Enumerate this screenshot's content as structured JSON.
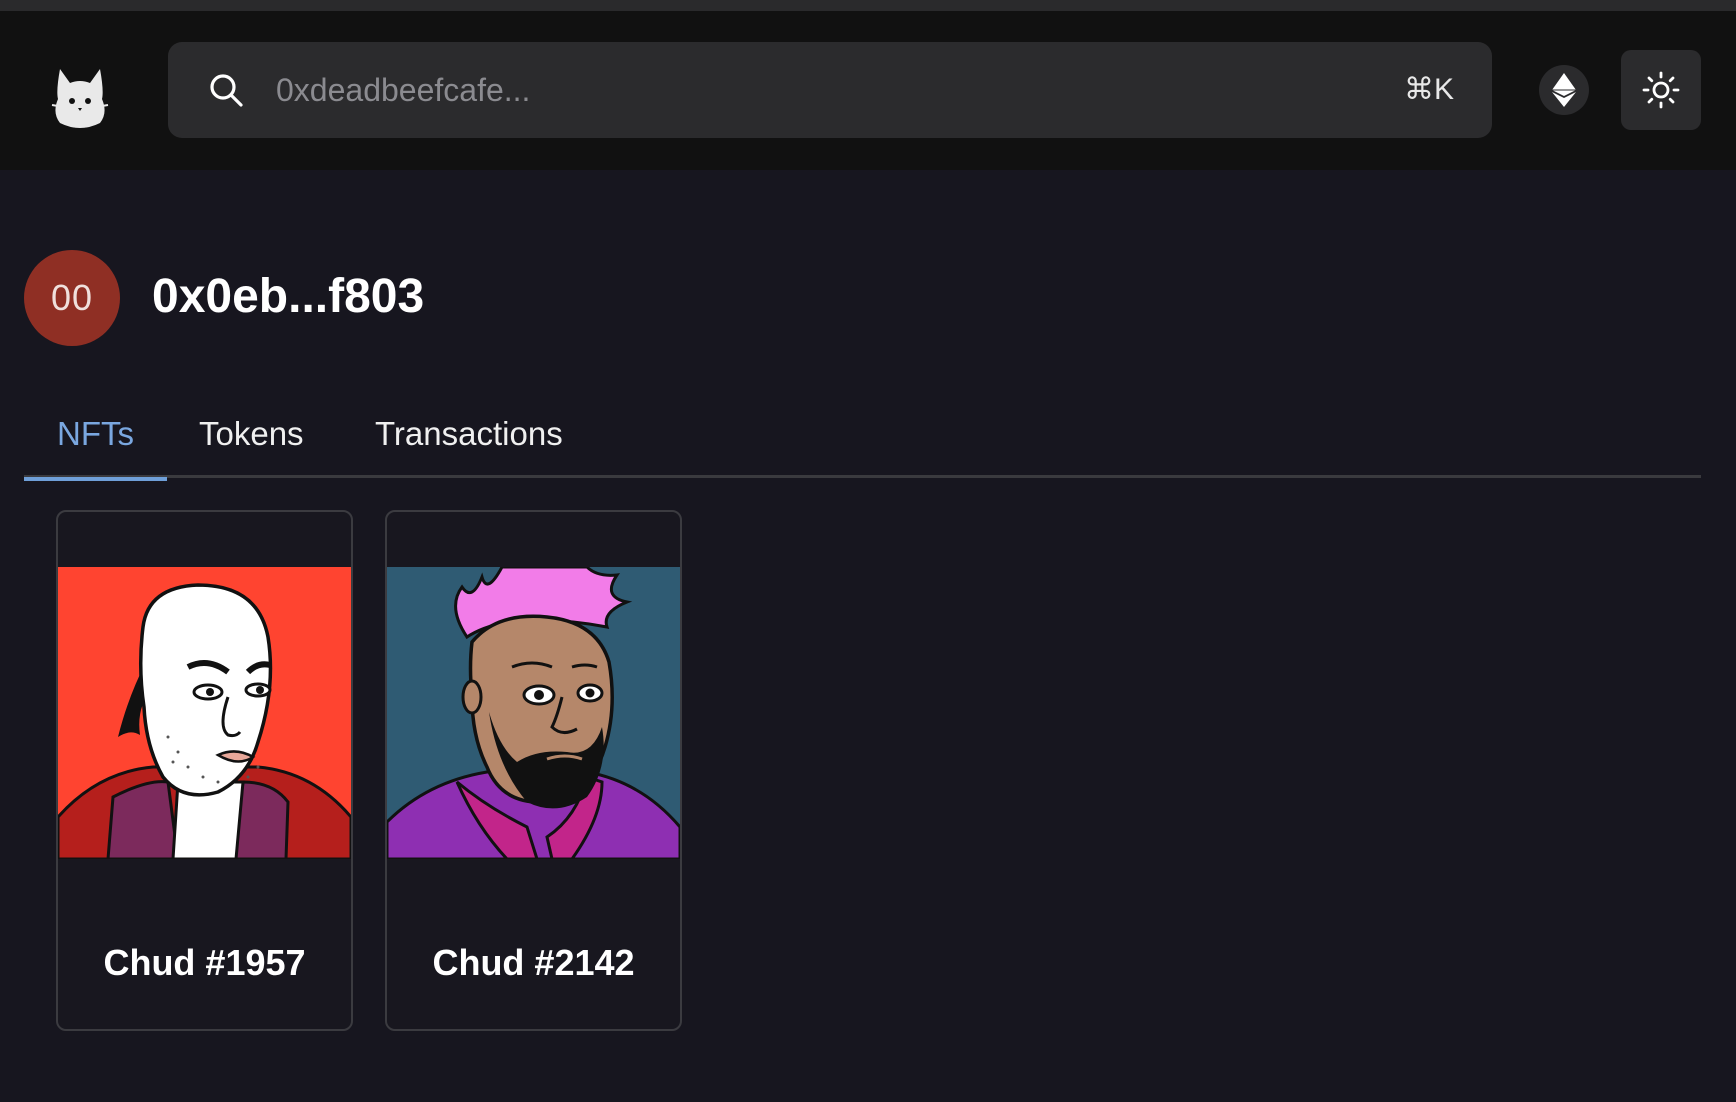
{
  "header": {
    "logo_icon": "cat-icon",
    "search": {
      "placeholder": "0xdeadbeefcafe...",
      "value": "",
      "shortcut": "⌘K",
      "icon": "search-icon"
    },
    "network_icon": "ethereum-icon",
    "theme_icon": "sun-icon"
  },
  "profile": {
    "avatar_text": "00",
    "avatar_color": "#8f2f24",
    "address": "0x0eb...f803"
  },
  "tabs": [
    {
      "label": "NFTs",
      "active": true
    },
    {
      "label": "Tokens",
      "active": false
    },
    {
      "label": "Transactions",
      "active": false
    }
  ],
  "nfts": [
    {
      "name": "Chud #1957",
      "background": "#ff4430"
    },
    {
      "name": "Chud #2142",
      "background": "#2f5b73"
    }
  ],
  "colors": {
    "accent": "#7aa7e0",
    "page_background": "#17161f",
    "header_background": "#111111"
  }
}
